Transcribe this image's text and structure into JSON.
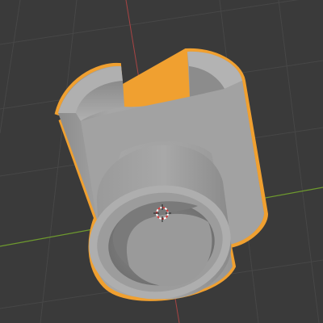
{
  "viewport": {
    "view": "3D Viewport",
    "background": "#3a3a3a",
    "grid_color": "#4a4a4a",
    "axis_x_color": "#6e9a2e",
    "axis_z_color": "#b04a4a",
    "selection_outline_color": "#f0a030",
    "object_color": "#9e9e9e",
    "object": {
      "type": "mesh",
      "shape": "tee-pipe-clip",
      "selected": true
    },
    "cursor": {
      "icon": "3d-cursor-icon"
    }
  }
}
